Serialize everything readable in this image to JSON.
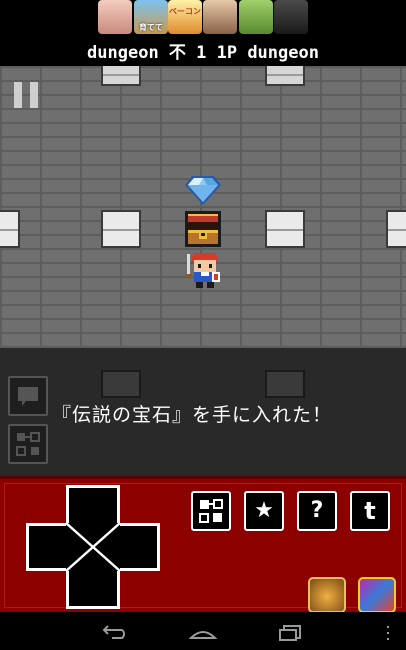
{
  "ads": {
    "icons": [
      {
        "name": "ad-app-1",
        "label": "",
        "color": "#e8b4a8"
      },
      {
        "name": "ad-app-2",
        "label": "育てて",
        "color": "#5aa0d8"
      },
      {
        "name": "ad-app-3",
        "label": "ベーコン",
        "color": "#f0c040"
      },
      {
        "name": "ad-app-4",
        "label": "",
        "color": "#c89070"
      },
      {
        "name": "ad-app-5",
        "label": "",
        "color": "#7ab050"
      },
      {
        "name": "ad-app-6",
        "label": "",
        "color": "#303030"
      }
    ]
  },
  "title": "dungeon of 1 tap dungeon",
  "title_display": "dungeon 不 1 1P dungeon",
  "message": "『伝説の宝石』を手に入れた！",
  "controls": {
    "buttons": [
      {
        "name": "map-button",
        "label": "▙▜"
      },
      {
        "name": "favorite-button",
        "label": "★"
      },
      {
        "name": "help-button",
        "label": "?"
      },
      {
        "name": "twitter-button",
        "label": "t"
      }
    ]
  },
  "colors": {
    "panel": "#8d0000",
    "floor": "#6f6f6f",
    "overlay": "#292929"
  }
}
